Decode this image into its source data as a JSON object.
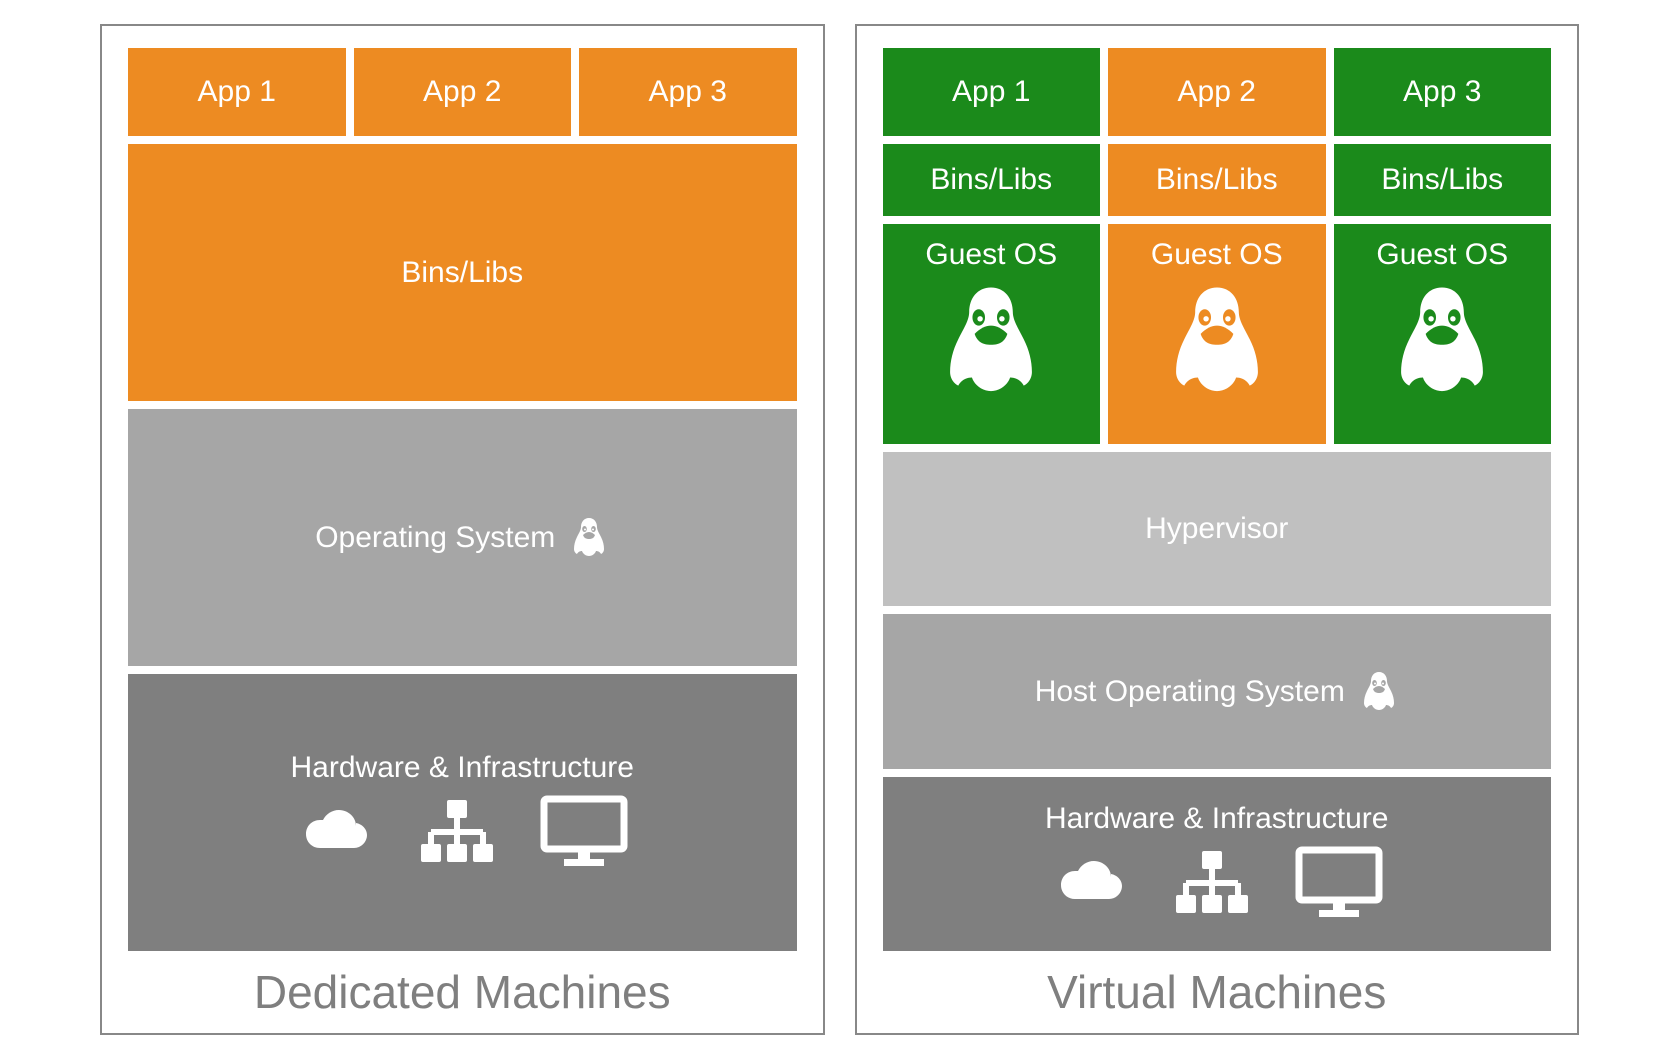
{
  "colors": {
    "orange": "#ed8b22",
    "green": "#1b8a1b",
    "gray_light": "#c0c0c0",
    "gray_mid": "#a6a6a6",
    "gray_dark": "#7f7f7f",
    "border": "#888888",
    "caption": "#7f7f7f"
  },
  "left": {
    "caption": "Dedicated Machines",
    "apps": [
      "App 1",
      "App 2",
      "App 3"
    ],
    "binslibs": "Bins/Libs",
    "os": "Operating System",
    "hardware": "Hardware & Infrastructure"
  },
  "right": {
    "caption": "Virtual Machines",
    "apps": [
      "App 1",
      "App 2",
      "App 3"
    ],
    "binslibs": [
      "Bins/Libs",
      "Bins/Libs",
      "Bins/Libs"
    ],
    "guest_os": [
      "Guest OS",
      "Guest OS",
      "Guest OS"
    ],
    "hypervisor": "Hypervisor",
    "host_os": "Host Operating System",
    "hardware": "Hardware & Infrastructure"
  },
  "icons": {
    "penguin": "penguin-icon",
    "cloud": "cloud-icon",
    "network": "network-icon",
    "monitor": "monitor-icon"
  }
}
